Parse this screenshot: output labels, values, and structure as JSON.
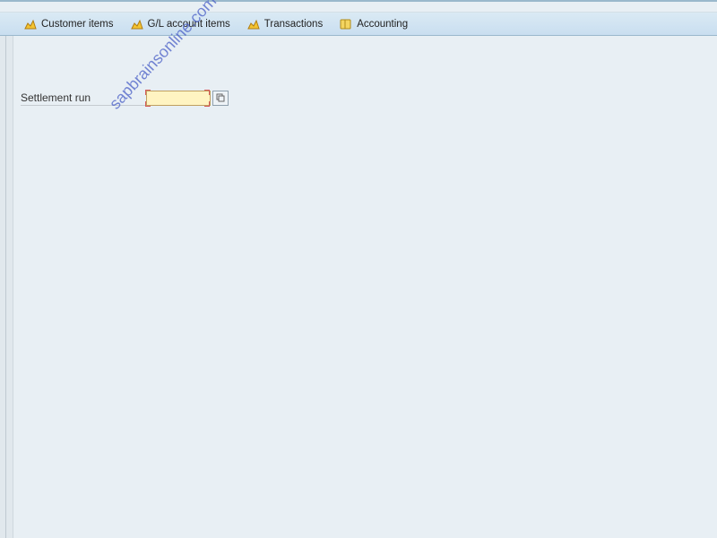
{
  "toolbar": {
    "items": [
      {
        "label": "Customer items",
        "icon": "report-icon"
      },
      {
        "label": "G/L account items",
        "icon": "report-icon"
      },
      {
        "label": "Transactions",
        "icon": "report-icon"
      },
      {
        "label": "Accounting",
        "icon": "book-icon"
      }
    ]
  },
  "form": {
    "settlement_run": {
      "label": "Settlement run",
      "value": ""
    }
  },
  "watermark": "sapbrainsonline.com"
}
